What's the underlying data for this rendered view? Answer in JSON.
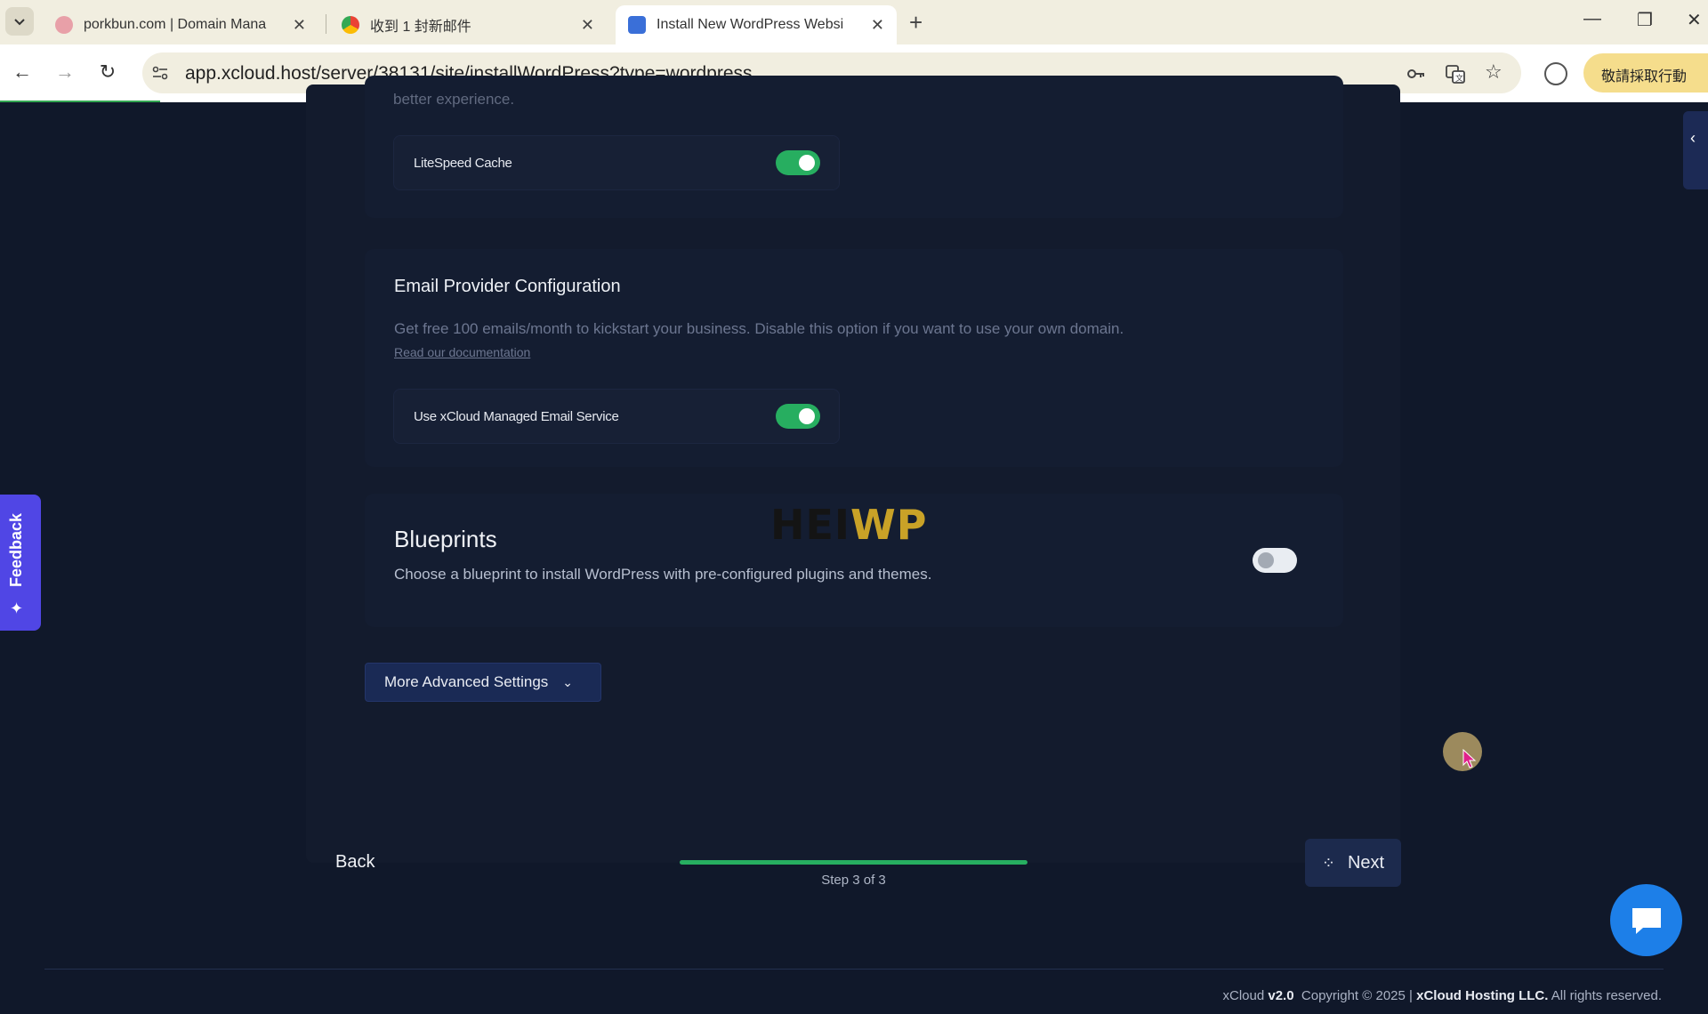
{
  "browser": {
    "tabs": [
      {
        "title": "porkbun.com | Domain Mana",
        "active": false
      },
      {
        "title": "收到 1 封新邮件",
        "active": false
      },
      {
        "title": "Install New WordPress Websi",
        "active": true
      }
    ],
    "url": "app.xcloud.host/server/38131/site/installWordPress?type=wordpress",
    "action_button": "敬請採取行動"
  },
  "page": {
    "faded_top_text": "better experience.",
    "litespeed": {
      "label": "LiteSpeed Cache",
      "enabled": true
    },
    "email": {
      "title": "Email Provider Configuration",
      "description": "Get free 100 emails/month to kickstart your business. Disable this option if you want to use your own domain.",
      "doc_link": "Read our documentation",
      "toggle_label": "Use xCloud Managed Email Service",
      "enabled": true
    },
    "blueprints": {
      "title": "Blueprints",
      "description": "Choose a blueprint to install WordPress with pre-configured plugins and themes.",
      "enabled": false
    },
    "watermark": {
      "part1": "HEI",
      "part2": "WP"
    },
    "advanced_button": "More Advanced Settings",
    "nav": {
      "back": "Back",
      "next": "Next",
      "step_text": "Step 3 of 3",
      "progress": 1.0
    },
    "feedback_label": "Feedback",
    "footer": {
      "brand": "xCloud",
      "version": "v2.0",
      "copyright": "Copyright © 2025 |",
      "company": "xCloud Hosting LLC.",
      "rights": "All rights reserved."
    }
  },
  "colors": {
    "accent_green": "#27ae60",
    "background": "#10182a",
    "feedback_purple": "#5046e5",
    "chat_blue": "#1d7fe8"
  }
}
